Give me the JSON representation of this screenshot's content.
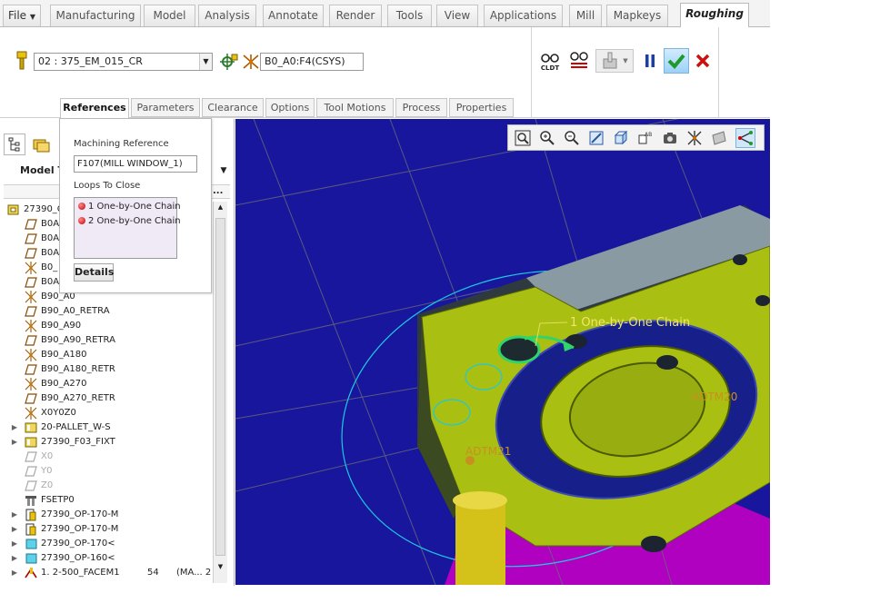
{
  "ribbon_tabs": [
    "File",
    "Manufacturing",
    "Model",
    "Analysis",
    "Annotate",
    "Render",
    "Tools",
    "View",
    "Applications",
    "Mill",
    "Mapkeys",
    "Roughing"
  ],
  "ribbon": {
    "tool_value": "02 : 375_EM_015_CR",
    "csys_value": "B0_A0:F4(CSYS)",
    "cldt_label": "CLDT"
  },
  "sub_tabs": [
    "References",
    "Parameters",
    "Clearance",
    "Options",
    "Tool Motions",
    "Process",
    "Properties"
  ],
  "references_panel": {
    "machining_reference_label": "Machining Reference",
    "machining_reference_value": "F107(MILL WINDOW_1)",
    "loops_label": "Loops To Close",
    "loops": [
      "1 One-by-One Chain",
      "2 One-by-One Chain"
    ],
    "details_label": "Details"
  },
  "model_tree": {
    "header_label": "Model T",
    "more_label": "...",
    "items": [
      {
        "label": "27390_C",
        "icon": "part-icon",
        "expand": ""
      },
      {
        "label": "B0A",
        "icon": "datum-plane-icon",
        "expand": ""
      },
      {
        "label": "B0A",
        "icon": "datum-plane-icon",
        "expand": ""
      },
      {
        "label": "B0A",
        "icon": "datum-plane-icon",
        "expand": ""
      },
      {
        "label": "B0_",
        "icon": "csys-icon",
        "expand": ""
      },
      {
        "label": "B0A",
        "icon": "datum-plane-icon",
        "expand": ""
      },
      {
        "label": "B90_A0",
        "icon": "csys-icon",
        "expand": ""
      },
      {
        "label": "B90_A0_RETRA",
        "icon": "datum-plane-icon",
        "expand": ""
      },
      {
        "label": "B90_A90",
        "icon": "csys-icon",
        "expand": ""
      },
      {
        "label": "B90_A90_RETRA",
        "icon": "datum-plane-icon",
        "expand": ""
      },
      {
        "label": "B90_A180",
        "icon": "csys-icon",
        "expand": ""
      },
      {
        "label": "B90_A180_RETR",
        "icon": "datum-plane-icon",
        "expand": ""
      },
      {
        "label": "B90_A270",
        "icon": "csys-icon",
        "expand": ""
      },
      {
        "label": "B90_A270_RETR",
        "icon": "datum-plane-icon",
        "expand": ""
      },
      {
        "label": "X0Y0Z0",
        "icon": "csys-icon",
        "expand": ""
      },
      {
        "label": "20-PALLET_W-S",
        "icon": "assembly-icon",
        "expand": "▶"
      },
      {
        "label": "27390_F03_FIXT",
        "icon": "assembly-icon",
        "expand": "▶"
      },
      {
        "label": "X0",
        "icon": "datum-plane-grey-icon",
        "expand": ""
      },
      {
        "label": "Y0",
        "icon": "datum-plane-grey-icon",
        "expand": ""
      },
      {
        "label": "Z0",
        "icon": "datum-plane-grey-icon",
        "expand": ""
      },
      {
        "label": "FSETP0",
        "icon": "fixture-icon",
        "expand": ""
      },
      {
        "label": "27390_OP-170-M",
        "icon": "operation-icon",
        "expand": "▶"
      },
      {
        "label": "27390_OP-170-M",
        "icon": "operation-icon",
        "expand": "▶"
      },
      {
        "label": "27390_OP-170<",
        "icon": "workpiece-icon",
        "expand": "▶"
      },
      {
        "label": "27390_OP-160<",
        "icon": "workpiece-icon",
        "expand": "▶"
      },
      {
        "label": "1. 2-500_FACEM1",
        "icon": "milling-step-icon",
        "expand": "▶",
        "col2": "54",
        "col3": "(MA... 2"
      }
    ]
  },
  "viewport": {
    "chain_label": "1 One-by-One Chain",
    "adtm_label_1": "ADTM21",
    "adtm_label_2": "ADTM20"
  }
}
